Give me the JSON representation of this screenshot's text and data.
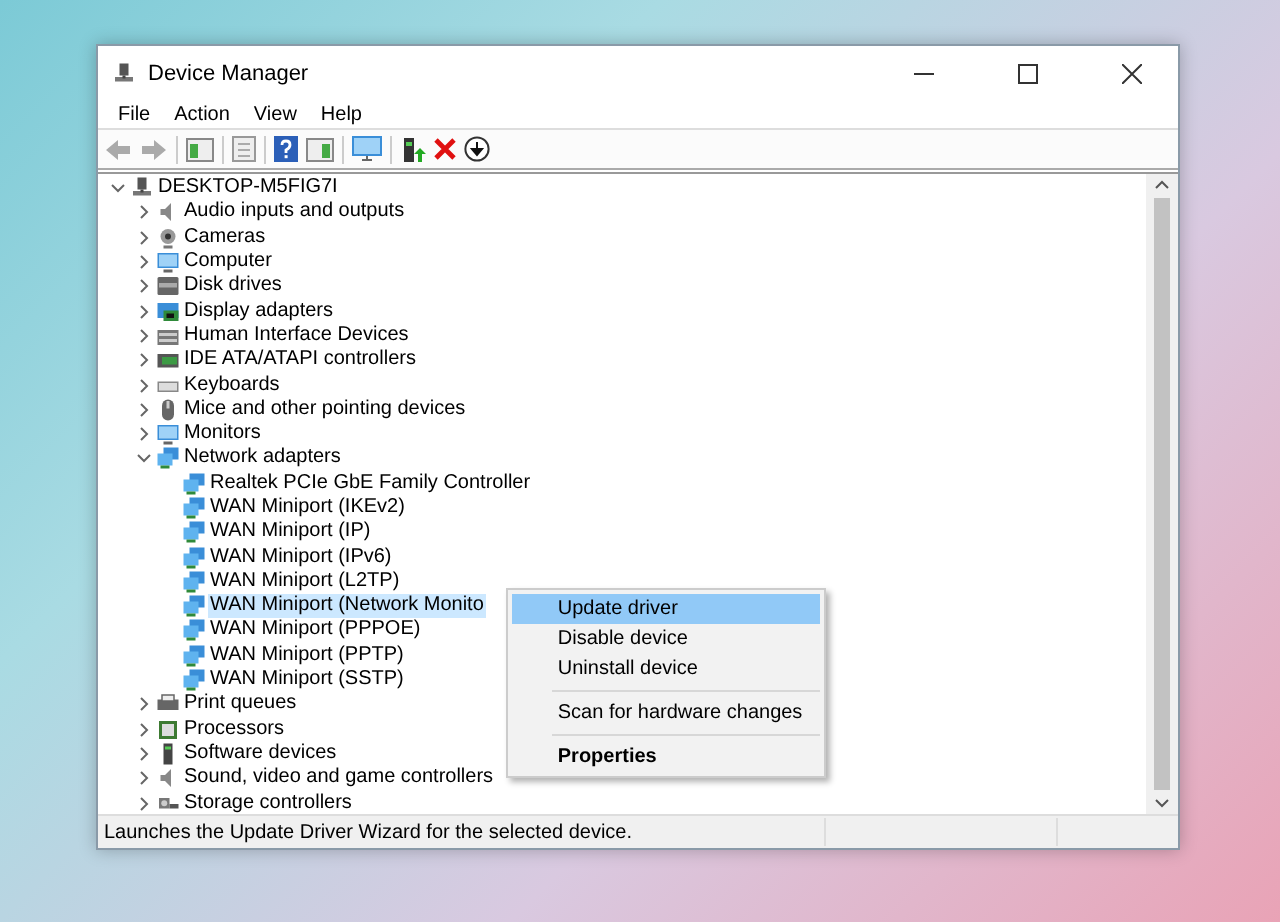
{
  "window": {
    "title": "Device Manager"
  },
  "menu_bar": [
    {
      "label": "File"
    },
    {
      "label": "Action"
    },
    {
      "label": "View"
    },
    {
      "label": "Help"
    }
  ],
  "tree": {
    "label": "DESKTOP-M5FIG7I",
    "kind": "computer-root",
    "expanded": true,
    "selected": false,
    "children": [
      {
        "label": "Audio inputs and outputs",
        "kind": "audio",
        "expanded": false,
        "selected": false
      },
      {
        "label": "Cameras",
        "kind": "camera",
        "expanded": false,
        "selected": false
      },
      {
        "label": "Computer",
        "kind": "monitor",
        "expanded": false,
        "selected": false
      },
      {
        "label": "Disk drives",
        "kind": "disk",
        "expanded": false,
        "selected": false
      },
      {
        "label": "Display adapters",
        "kind": "display",
        "expanded": false,
        "selected": false
      },
      {
        "label": "Human Interface Devices",
        "kind": "hid",
        "expanded": false,
        "selected": false
      },
      {
        "label": "IDE ATA/ATAPI controllers",
        "kind": "ide",
        "expanded": false,
        "selected": false
      },
      {
        "label": "Keyboards",
        "kind": "keyboard",
        "expanded": false,
        "selected": false
      },
      {
        "label": "Mice and other pointing devices",
        "kind": "mouse",
        "expanded": false,
        "selected": false
      },
      {
        "label": "Monitors",
        "kind": "monitor",
        "expanded": false,
        "selected": false
      },
      {
        "label": "Network adapters",
        "kind": "network",
        "expanded": true,
        "selected": false,
        "children": [
          {
            "label": "Realtek PCIe GbE Family Controller",
            "kind": "network",
            "selected": false
          },
          {
            "label": "WAN Miniport (IKEv2)",
            "kind": "network",
            "selected": false
          },
          {
            "label": "WAN Miniport (IP)",
            "kind": "network",
            "selected": false
          },
          {
            "label": "WAN Miniport (IPv6)",
            "kind": "network",
            "selected": false
          },
          {
            "label": "WAN Miniport (L2TP)",
            "kind": "network",
            "selected": false
          },
          {
            "label": "WAN Miniport (Network Monito",
            "kind": "network",
            "selected": true
          },
          {
            "label": "WAN Miniport (PPPOE)",
            "kind": "network",
            "selected": false
          },
          {
            "label": "WAN Miniport (PPTP)",
            "kind": "network",
            "selected": false
          },
          {
            "label": "WAN Miniport (SSTP)",
            "kind": "network",
            "selected": false
          }
        ]
      },
      {
        "label": "Print queues",
        "kind": "printer",
        "expanded": false,
        "selected": false
      },
      {
        "label": "Processors",
        "kind": "processor",
        "expanded": false,
        "selected": false
      },
      {
        "label": "Software devices",
        "kind": "software",
        "expanded": false,
        "selected": false
      },
      {
        "label": "Sound, video and game controllers",
        "kind": "audio",
        "expanded": false,
        "selected": false
      },
      {
        "label": "Storage controllers",
        "kind": "storage",
        "expanded": false,
        "selected": false
      }
    ]
  },
  "context_menu": {
    "items": [
      {
        "kind": "item",
        "label": "Update driver",
        "selected": true
      },
      {
        "kind": "item",
        "label": "Disable device",
        "selected": false
      },
      {
        "kind": "item",
        "label": "Uninstall device",
        "selected": false
      },
      {
        "kind": "separator"
      },
      {
        "kind": "item",
        "label": "Scan for hardware changes",
        "selected": false
      },
      {
        "kind": "separator"
      },
      {
        "kind": "default",
        "label": "Properties",
        "selected": false
      }
    ]
  },
  "status_bar": {
    "text": "Launches the Update Driver Wizard for the selected device."
  }
}
